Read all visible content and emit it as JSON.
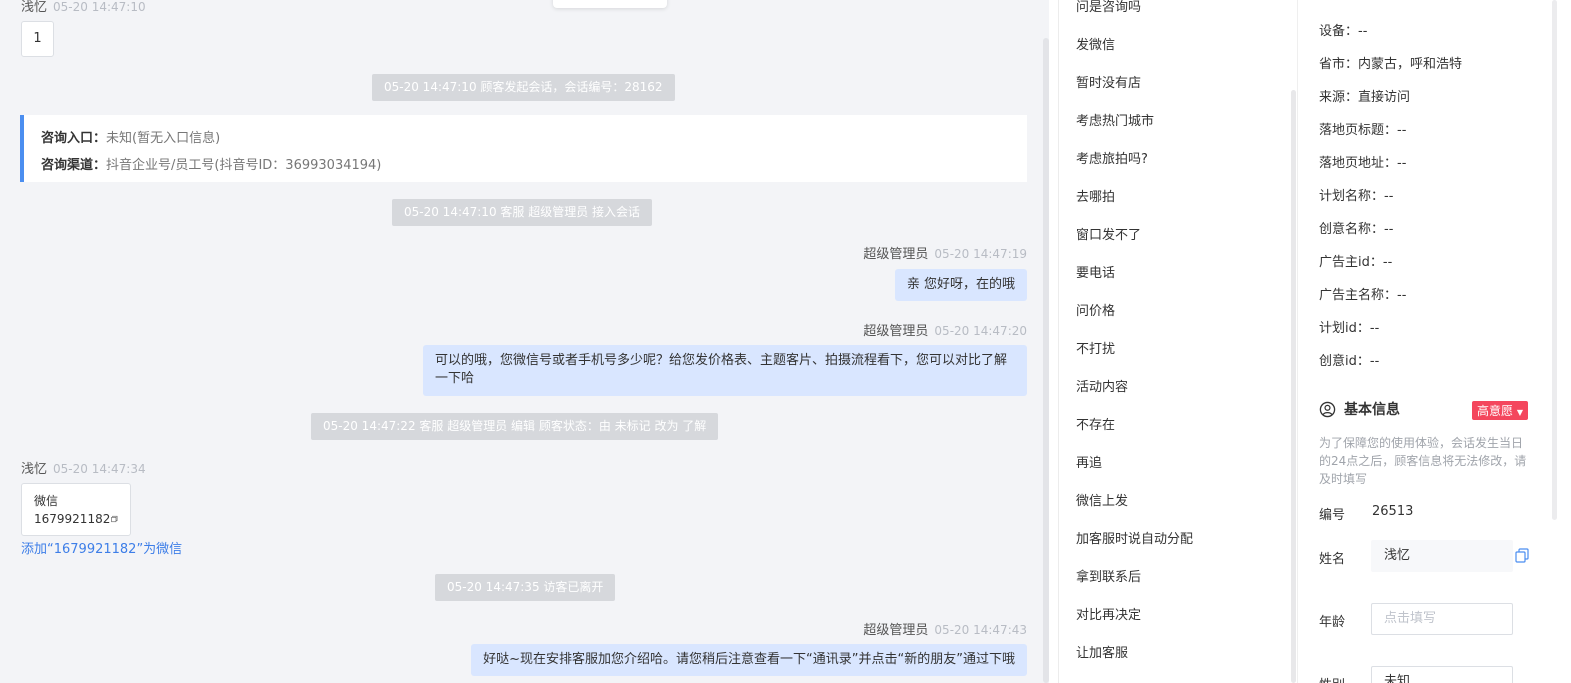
{
  "chat": {
    "top_visitor": {
      "name": "浅忆",
      "time": "05-20 14:47:10",
      "msg": "1"
    },
    "sys1": "05-20 14:47:10 顾客发起会话，会话编号：28162",
    "info": {
      "entry_label": "咨询入口：",
      "entry_value": "未知(暂无入口信息)",
      "channel_label": "咨询渠道：",
      "channel_value": "抖音企业号/员工号(抖音号ID：36993034194)"
    },
    "sys2": "05-20 14:47:10 客服 超级管理员 接入会话",
    "agent_msg1": {
      "name": "超级管理员",
      "time": "05-20 14:47:19",
      "text": "亲 您好呀，在的哦"
    },
    "agent_msg2": {
      "name": "超级管理员",
      "time": "05-20 14:47:20",
      "line1": "可以的哦，您微信号或者手机号多少呢？给您发价格表、主题客片、拍摄流程看下，您可以对比了解",
      "line2": "一下哈"
    },
    "sys3": "05-20 14:47:22 客服 超级管理员 编辑 顾客状态：由 未标记 改为 了解",
    "visitor_msg": {
      "name": "浅忆",
      "time": "05-20 14:47:34",
      "card_title": "微信",
      "card_value": "1679921182",
      "add_link": "添加“1679921182”为微信"
    },
    "sys4": "05-20 14:47:35 访客已离开",
    "agent_msg3": {
      "name": "超级管理员",
      "time": "05-20 14:47:43",
      "text": "好哒~现在安排客服加您介绍哈。请您稍后注意查看一下“通讯录”并点击“新的朋友”通过下哦"
    }
  },
  "quick_replies": [
    "问是咨询吗",
    "发微信",
    "暂时没有店",
    "考虑热门城市",
    "考虑旅拍吗?",
    "去哪拍",
    "窗口发不了",
    "要电话",
    "问价格",
    "不打扰",
    "活动内容",
    "不存在",
    "再追",
    "微信上发",
    "加客服时说自动分配",
    "拿到联系后",
    "对比再决定",
    "让加客服",
    "…"
  ],
  "panel": {
    "fields": [
      {
        "label": "设备：",
        "value": "--"
      },
      {
        "label": "省市：",
        "value": "内蒙古，呼和浩特"
      },
      {
        "label": "来源：",
        "value": "直接访问"
      },
      {
        "label": "落地页标题：",
        "value": "--"
      },
      {
        "label": "落地页地址：",
        "value": "--"
      },
      {
        "label": "计划名称：",
        "value": "--"
      },
      {
        "label": "创意名称：",
        "value": "--"
      },
      {
        "label": "广告主id：",
        "value": "--"
      },
      {
        "label": "广告主名称：",
        "value": "--"
      },
      {
        "label": "计划id：",
        "value": "--"
      },
      {
        "label": "创意id：",
        "value": "--"
      }
    ],
    "basic_title": "基本信息",
    "intent_badge": "高意愿",
    "note": "为了保障您的使用体验，会话发生当日的24点之后，顾客信息将无法修改，请及时填写",
    "id_label": "编号",
    "id_value": "26513",
    "name_label": "姓名",
    "name_value": "浅忆",
    "age_label": "年龄",
    "age_placeholder": "点击填写",
    "gender_label": "性别",
    "gender_value": "未知"
  }
}
